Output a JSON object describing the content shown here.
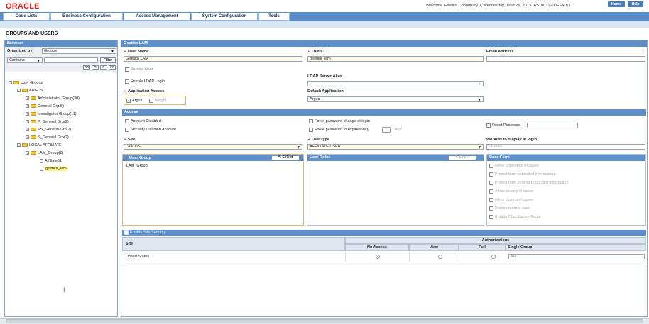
{
  "header": {
    "logo": "ORACLE",
    "welcome": "Welcome Geetika Choudhary J, Wednesday, June 26, 2013 (AS7003T2-DEFAULT)",
    "home_label": "Home",
    "help_label": "Help"
  },
  "menu": [
    "Code Lists",
    "Business Configuration",
    "Access Management",
    "System Configuration",
    "Tools"
  ],
  "page_title": "GROUPS AND USERS",
  "browser": {
    "title": "Browser",
    "organized_by_label": "Organized by",
    "organized_by_value": "Groups",
    "filter_mode": "Contains",
    "filter_value": "",
    "filter_button": "Filter",
    "pager": [
      "<<",
      "<",
      ">",
      ">>"
    ],
    "tree": {
      "root": "User Groups",
      "argus": "ARGUS",
      "argus_children": [
        "Administrator Group(30)",
        "General Grp(5)",
        "Investigator Group(11)",
        "P_General Grp(2)",
        "PS_General Grp(2)",
        "S_General Grp(2)"
      ],
      "local": "LOCAL AFFILIATE",
      "lam_group": "LAM_Group(2)",
      "lam_users": [
        "Affiliate01",
        "geetika_lam"
      ]
    }
  },
  "user": {
    "panel_title": "Geetika LAM",
    "user_name_label": "User Name",
    "user_name": "Geetika LAM",
    "user_id_label": "UserID",
    "user_id": "geetika_lam",
    "email_label": "Email Address",
    "email": "",
    "service_user": "Service User",
    "enable_ldap": "Enable LDAP Login",
    "ldap_alias_label": "LDAP Server Alias",
    "ldap_alias": "",
    "app_access_label": "Application Access",
    "app_argus": "Argus",
    "app_insight": "Insight",
    "default_app_label": "Default Application",
    "default_app": "Argus"
  },
  "access": {
    "title": "Access",
    "account_disabled": "Account Disabled",
    "security_disabled": "Security Disabled Account",
    "force_change": "Force password change at login",
    "force_expire": "Force password to expire every",
    "days": "Days",
    "reset_password": "Reset Password",
    "reset_value": ""
  },
  "site": {
    "site_label": "Site",
    "site_value": "LAM US",
    "usertype_label": "UserType",
    "usertype_value": "AFFILIATE USER",
    "worklist_label": "Worklist to display at login",
    "worklist_value": "--None--"
  },
  "groups": {
    "user_group_title": "User Group",
    "select_label": "Select",
    "user_group_items": [
      "LAM_Group"
    ],
    "user_roles_title": "User Roles",
    "case_form_title": "Case Form",
    "case_form_items": [
      "Allow unblinding of cases",
      "Protect from unblinded information",
      "Protect from printing unblinded information",
      "Allow locking of cases",
      "Allow closing of cases",
      "Route on close case",
      "Enable Checklist on Route"
    ]
  },
  "site_security": {
    "enable_label": "Enable Site Security",
    "site_col": "Site",
    "authorizations": "Authorizations",
    "cols": [
      "No Access",
      "View",
      "Full",
      "Single Group"
    ],
    "rows": [
      {
        "site": "United States",
        "selected": "No Access",
        "single_group": "AA"
      }
    ]
  }
}
